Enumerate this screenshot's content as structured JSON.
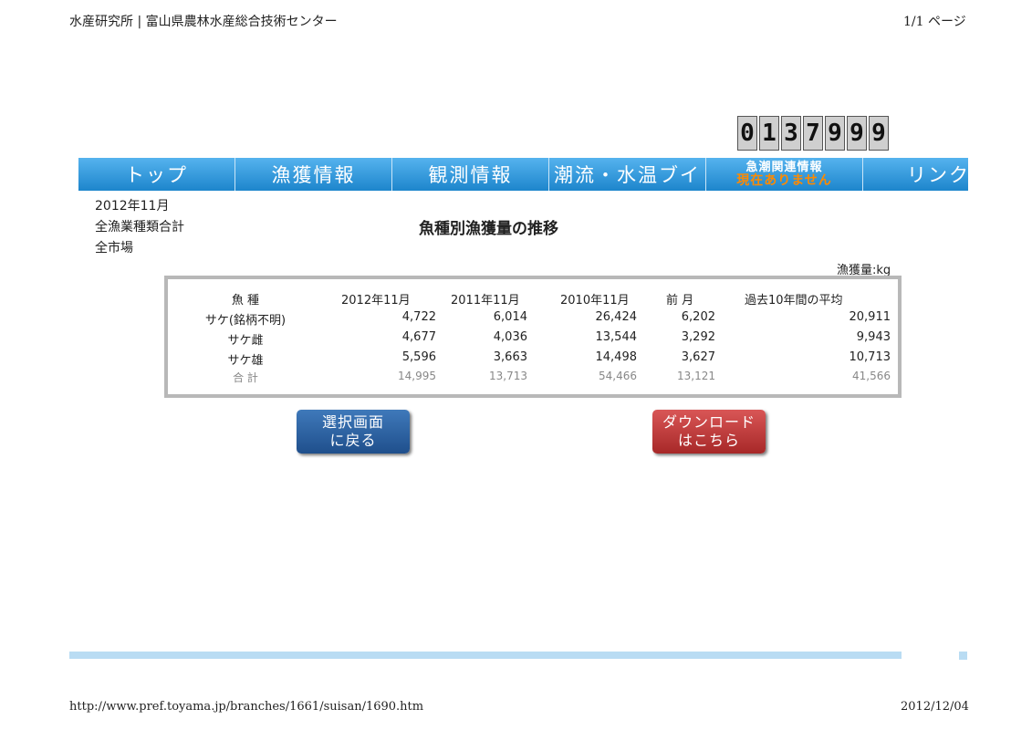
{
  "print_header": {
    "left": "水産研究所 | 富山県農林水産総合技術センター",
    "right": "1/1 ページ"
  },
  "counter": {
    "digits": [
      "0",
      "1",
      "3",
      "7",
      "9",
      "9",
      "9"
    ]
  },
  "nav": {
    "items": [
      "トップ",
      "漁獲情報",
      "観測情報",
      "潮流・水温ブイ"
    ],
    "emergency_title": "急潮関連情報",
    "emergency_status": "現在ありません",
    "last_item": "リンク"
  },
  "meta": {
    "date": "2012年11月",
    "category": "全漁業種類合計",
    "market": "全市場"
  },
  "page_title": "魚種別漁獲量の推移",
  "unit_label": "漁獲量:kg",
  "table": {
    "headers": [
      "魚 種",
      "2012年11月",
      "2011年11月",
      "2010年11月",
      "前 月",
      "過去10年間の平均"
    ],
    "rows": [
      {
        "species": "サケ(銘柄不明)",
        "v2012": "4,722",
        "v2011": "6,014",
        "v2010": "26,424",
        "prev": "6,202",
        "avg": "20,911"
      },
      {
        "species": "サケ雌",
        "v2012": "4,677",
        "v2011": "4,036",
        "v2010": "13,544",
        "prev": "3,292",
        "avg": "9,943"
      },
      {
        "species": "サケ雄",
        "v2012": "5,596",
        "v2011": "3,663",
        "v2010": "14,498",
        "prev": "3,627",
        "avg": "10,713"
      }
    ],
    "total": {
      "species": "合 計",
      "v2012": "14,995",
      "v2011": "13,713",
      "v2010": "54,466",
      "prev": "13,121",
      "avg": "41,566"
    }
  },
  "buttons": {
    "back_line1": "選択画面",
    "back_line2": "に戻る",
    "download_line1": "ダウンロード",
    "download_line2": "はこちら"
  },
  "footer": {
    "url": "http://www.pref.toyama.jp/branches/1661/suisan/1690.htm",
    "date": "2012/12/04"
  },
  "colors": {
    "nav_blue": "#2a95dc",
    "emergency_orange": "#ff8a00",
    "back_button": "#2a5f9e",
    "download_button": "#c03a3a"
  }
}
